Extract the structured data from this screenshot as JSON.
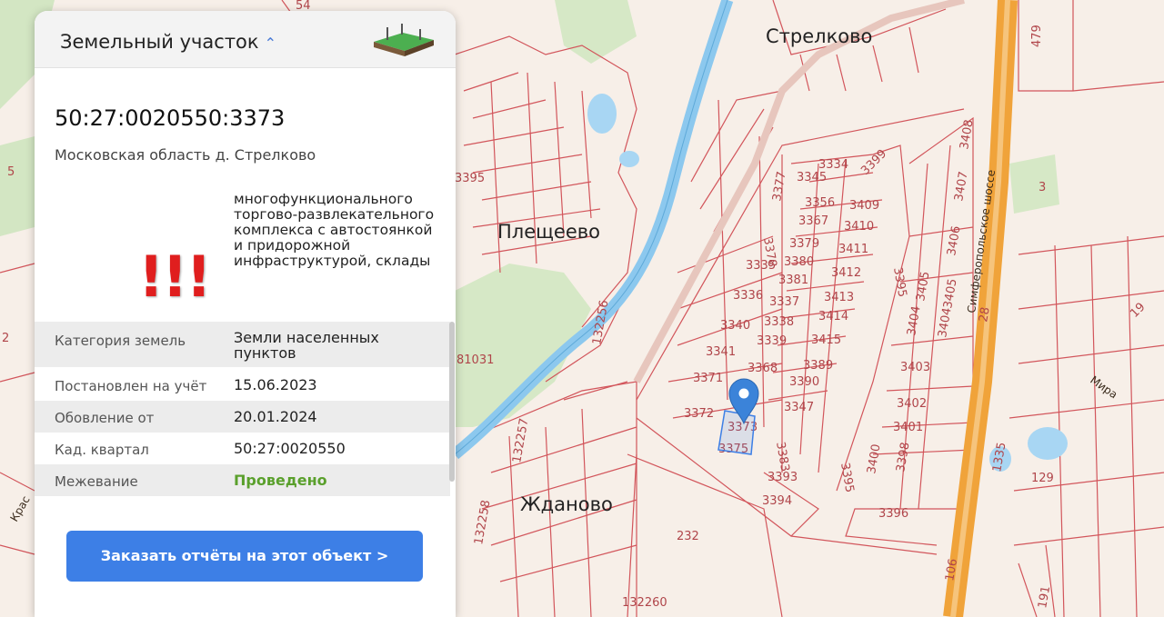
{
  "map": {
    "towns": {
      "strelkovo": "Стрелково",
      "pleshcheevo": "Плещеево",
      "zhdanovo": "Ждановo"
    },
    "road_name": "Симферопольское шоссе",
    "street_mira": "Мира",
    "street_kras": "Крас",
    "edge_labels": {
      "top": "54",
      "top_right": "479",
      "left_5": "5",
      "left_2": "2"
    },
    "marker_icon": "location-pin-icon",
    "parcels": [
      {
        "id": "p3334",
        "label": "3334"
      },
      {
        "id": "p3345",
        "label": "3345"
      },
      {
        "id": "p3399",
        "label": "3399"
      },
      {
        "id": "p3377",
        "label": "3377"
      },
      {
        "id": "p3356",
        "label": "3356"
      },
      {
        "id": "p3409",
        "label": "3409"
      },
      {
        "id": "p3367",
        "label": "3367"
      },
      {
        "id": "p3410",
        "label": "3410"
      },
      {
        "id": "p3378",
        "label": "3378"
      },
      {
        "id": "p3379",
        "label": "3379"
      },
      {
        "id": "p3411",
        "label": "3411"
      },
      {
        "id": "p3380",
        "label": "3380"
      },
      {
        "id": "p3335",
        "label": "3335"
      },
      {
        "id": "p3381",
        "label": "3381"
      },
      {
        "id": "p3412",
        "label": "3412"
      },
      {
        "id": "p3336",
        "label": "3336"
      },
      {
        "id": "p3337",
        "label": "3337"
      },
      {
        "id": "p3413",
        "label": "3413"
      },
      {
        "id": "p3338",
        "label": "3338"
      },
      {
        "id": "p3414",
        "label": "3414"
      },
      {
        "id": "p3340",
        "label": "3340"
      },
      {
        "id": "p3339",
        "label": "3339"
      },
      {
        "id": "p3415",
        "label": "3415"
      },
      {
        "id": "p3341",
        "label": "3341"
      },
      {
        "id": "p3368",
        "label": "3368"
      },
      {
        "id": "p3389",
        "label": "3389"
      },
      {
        "id": "p3371",
        "label": "3371"
      },
      {
        "id": "p3390",
        "label": "3390"
      },
      {
        "id": "p3347",
        "label": "3347"
      },
      {
        "id": "p3372",
        "label": "3372"
      },
      {
        "id": "p3373",
        "label": "3373"
      },
      {
        "id": "p3375",
        "label": "3375"
      },
      {
        "id": "p3383",
        "label": "3383"
      },
      {
        "id": "p3393",
        "label": "3393"
      },
      {
        "id": "p3394",
        "label": "3394"
      },
      {
        "id": "p3395a",
        "label": "3395"
      },
      {
        "id": "p3395b",
        "label": "3395"
      },
      {
        "id": "p3395c",
        "label": "3395"
      },
      {
        "id": "p3396",
        "label": "3396"
      },
      {
        "id": "p3400",
        "label": "3400"
      },
      {
        "id": "p3398",
        "label": "3398"
      },
      {
        "id": "p3401",
        "label": "3401"
      },
      {
        "id": "p3402",
        "label": "3402"
      },
      {
        "id": "p3403",
        "label": "3403"
      },
      {
        "id": "p3404a",
        "label": "3404"
      },
      {
        "id": "p3404b",
        "label": "3404"
      },
      {
        "id": "p3405a",
        "label": "3405"
      },
      {
        "id": "p3405b",
        "label": "3405"
      },
      {
        "id": "p3406",
        "label": "3406"
      },
      {
        "id": "p3407",
        "label": "3407"
      },
      {
        "id": "p3408",
        "label": "3408"
      },
      {
        "id": "p132256",
        "label": "132256"
      },
      {
        "id": "p132257",
        "label": "132257"
      },
      {
        "id": "p132258",
        "label": "132258"
      },
      {
        "id": "p132260",
        "label": "132260"
      },
      {
        "id": "p232",
        "label": "232"
      },
      {
        "id": "p129",
        "label": "129"
      },
      {
        "id": "p1335",
        "label": "1335"
      },
      {
        "id": "p81031",
        "label": "81031"
      },
      {
        "id": "p106",
        "label": "106"
      },
      {
        "id": "p28",
        "label": "28"
      },
      {
        "id": "p191",
        "label": "191"
      },
      {
        "id": "p19",
        "label": "19"
      },
      {
        "id": "p3",
        "label": "3"
      }
    ]
  },
  "panel": {
    "header_title": "Земельный участок",
    "header_chevron": "chevron-up-icon",
    "header_icon": "land-plot-icon",
    "cadastral_number": "50:27:0020550:3373",
    "address": "Московская область д. Стрелково",
    "warning_mark": "!!!",
    "purpose": "многофункционального торгово-развлекательного комплекса с автостоянкой и придорожной инфраструктурой, склады",
    "rows": [
      {
        "key": "Категория земель",
        "value": "Земли населенных пунктов"
      },
      {
        "key": "Постановлен на учёт",
        "value": "15.06.2023"
      },
      {
        "key": "Обовление от",
        "value": "20.01.2024"
      },
      {
        "key": "Кад. квартал",
        "value": "50:27:0020550"
      },
      {
        "key": "Межевание",
        "value": "Проведено"
      }
    ],
    "order_button": "Заказать отчёты на этот объект >"
  },
  "colors": {
    "accent": "#3d7fe6",
    "status_ok": "#5aa02c",
    "parcel_line": "#d2555b",
    "river": "#8cc8ee",
    "highway": "#f0a33a"
  }
}
